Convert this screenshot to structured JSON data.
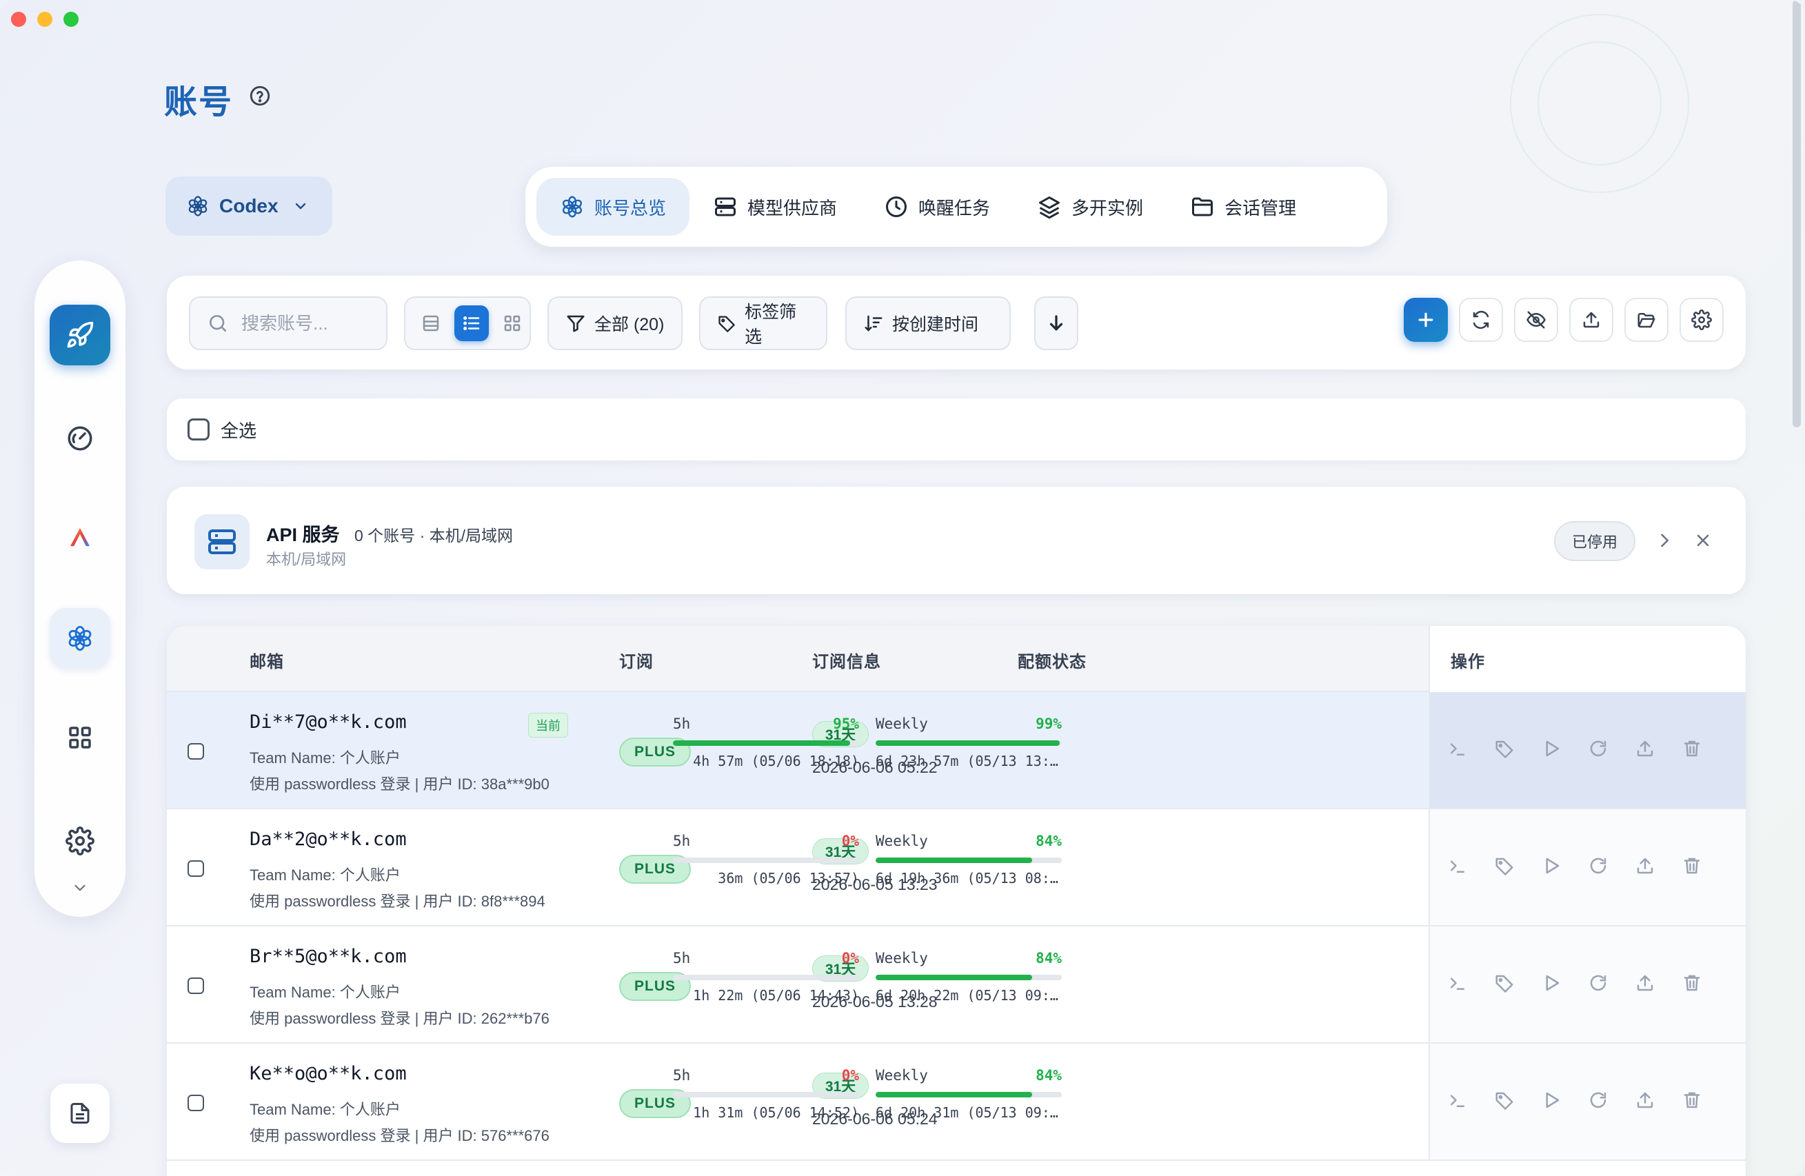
{
  "page": {
    "title": "账号"
  },
  "provider_select": {
    "label": "Codex"
  },
  "tabs": [
    {
      "label": "账号总览",
      "icon": "openai-icon",
      "active": true
    },
    {
      "label": "模型供应商",
      "icon": "server-icon"
    },
    {
      "label": "唤醒任务",
      "icon": "clock-icon"
    },
    {
      "label": "多开实例",
      "icon": "layers-icon"
    },
    {
      "label": "会话管理",
      "icon": "folder-icon"
    }
  ],
  "toolbar": {
    "search_placeholder": "搜索账号...",
    "filter_all": "全部 (20)",
    "tag_filter": "标签筛选",
    "sort": "按创建时间"
  },
  "select_all": "全选",
  "api_service": {
    "title": "API 服务",
    "meta": "0 个账号 · 本机/局域网",
    "subtitle": "本机/局域网",
    "status": "已停用"
  },
  "table": {
    "headers": {
      "email": "邮箱",
      "plan": "订阅",
      "plan_info": "订阅信息",
      "quota": "配额状态",
      "ops": "操作"
    },
    "rows": [
      {
        "email": "Di**7@o**k.com",
        "current_badge": "当前",
        "team": "Team Name: 个人账户",
        "login": "使用 passwordless 登录 | 用户 ID: 38a***9b0",
        "plan": "PLUS",
        "days": "31天",
        "expire": "2026-06-06 05:22",
        "q5_label": "5h",
        "q5_pct": "95%",
        "q5_val": 95,
        "q5_reset": "4h 57m (05/06 18:18)",
        "qw_label": "Weekly",
        "qw_pct": "99%",
        "qw_val": 99,
        "qw_reset": "6d 23h 57m (05/13 13:…"
      },
      {
        "email": "Da**2@o**k.com",
        "team": "Team Name: 个人账户",
        "login": "使用 passwordless 登录 | 用户 ID: 8f8***894",
        "plan": "PLUS",
        "days": "31天",
        "expire": "2026-06-05 13:23",
        "q5_label": "5h",
        "q5_pct": "0%",
        "q5_val": 0,
        "q5_reset": "36m (05/06 13:57)",
        "qw_label": "Weekly",
        "qw_pct": "84%",
        "qw_val": 84,
        "qw_reset": "6d 19h 36m (05/13 08:…"
      },
      {
        "email": "Br**5@o**k.com",
        "team": "Team Name: 个人账户",
        "login": "使用 passwordless 登录 | 用户 ID: 262***b76",
        "plan": "PLUS",
        "days": "31天",
        "expire": "2026-06-05 13:28",
        "q5_label": "5h",
        "q5_pct": "0%",
        "q5_val": 0,
        "q5_reset": "1h 22m (05/06 14:43)",
        "qw_label": "Weekly",
        "qw_pct": "84%",
        "qw_val": 84,
        "qw_reset": "6d 20h 22m (05/13 09:…"
      },
      {
        "email": "Ke**o@o**k.com",
        "team": "Team Name: 个人账户",
        "login": "使用 passwordless 登录 | 用户 ID: 576***676",
        "plan": "PLUS",
        "days": "31天",
        "expire": "2026-06-06 05:24",
        "q5_label": "5h",
        "q5_pct": "0%",
        "q5_val": 0,
        "q5_reset": "1h 31m (05/06 14:52)",
        "qw_label": "Weekly",
        "qw_pct": "84%",
        "qw_val": 84,
        "qw_reset": "6d 20h 31m (05/13 09:…"
      }
    ]
  },
  "colors": {
    "accent": "#1d64b4",
    "primary_button": "#1d74d8",
    "green": "#22b14c",
    "red": "#e5484d"
  }
}
